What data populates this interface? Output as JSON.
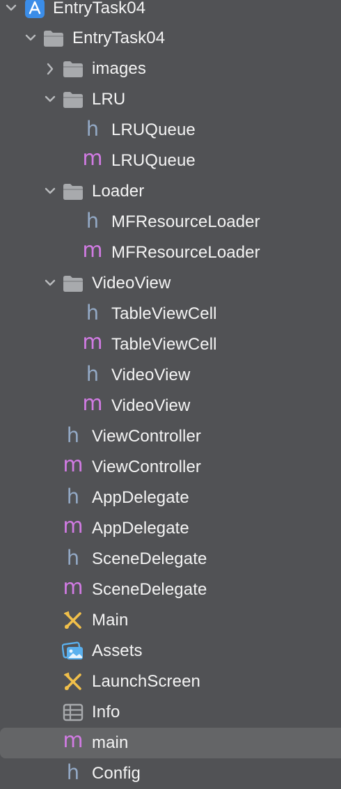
{
  "tree": {
    "project": {
      "label": "EntryTask04"
    },
    "group_root": {
      "label": "EntryTask04"
    },
    "images": {
      "label": "images"
    },
    "lru": {
      "label": "LRU"
    },
    "lru_h": {
      "label": "LRUQueue",
      "icon": "h"
    },
    "lru_m": {
      "label": "LRUQueue",
      "icon": "m"
    },
    "loader": {
      "label": "Loader"
    },
    "loader_h": {
      "label": "MFResourceLoader",
      "icon": "h"
    },
    "loader_m": {
      "label": "MFResourceLoader",
      "icon": "m"
    },
    "videoview": {
      "label": "VideoView"
    },
    "cell_h": {
      "label": "TableViewCell",
      "icon": "h"
    },
    "cell_m": {
      "label": "TableViewCell",
      "icon": "m"
    },
    "video_h": {
      "label": "VideoView",
      "icon": "h"
    },
    "video_m": {
      "label": "VideoView",
      "icon": "m"
    },
    "vc_h": {
      "label": "ViewController",
      "icon": "h"
    },
    "vc_m": {
      "label": "ViewController",
      "icon": "m"
    },
    "app_h": {
      "label": "AppDelegate",
      "icon": "h"
    },
    "app_m": {
      "label": "AppDelegate",
      "icon": "m"
    },
    "scene_h": {
      "label": "SceneDelegate",
      "icon": "h"
    },
    "scene_m": {
      "label": "SceneDelegate",
      "icon": "m"
    },
    "main_sb": {
      "label": "Main"
    },
    "assets": {
      "label": "Assets"
    },
    "launch": {
      "label": "LaunchScreen"
    },
    "info": {
      "label": "Info"
    },
    "main_m": {
      "label": "main",
      "icon": "m",
      "selected": true
    },
    "config": {
      "label": "Config",
      "icon": "h"
    }
  },
  "colors": {
    "background": "#515255",
    "selected_row": "#646567",
    "header_icon": "#93a9c5",
    "source_icon": "#d17be3",
    "folder": "#a8aaad",
    "storyboard": "#f1c04a",
    "assets": "#5ab0ee",
    "project": "#3b8de8"
  }
}
